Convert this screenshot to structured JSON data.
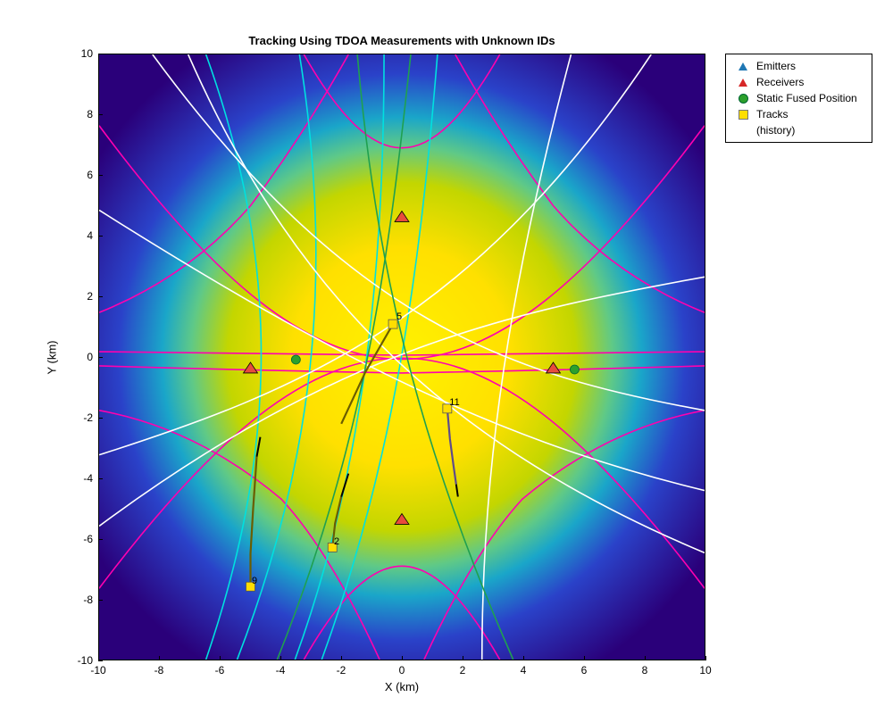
{
  "chart_data": {
    "type": "scatter",
    "title": "Tracking Using TDOA Measurements with Unknown IDs",
    "xlabel": "X (km)",
    "ylabel": "Y (km)",
    "xlim": [
      -10,
      10
    ],
    "ylim": [
      -10,
      10
    ],
    "xticks": [
      -10,
      -8,
      -6,
      -4,
      -2,
      0,
      2,
      4,
      6,
      8,
      10
    ],
    "yticks": [
      -10,
      -8,
      -6,
      -4,
      -2,
      0,
      2,
      4,
      6,
      8,
      10
    ],
    "legend": [
      "Emitters",
      "Receivers",
      "Static Fused Position",
      "Tracks",
      "(history)"
    ],
    "receivers": [
      {
        "x": -5.0,
        "y": 0.0
      },
      {
        "x": 5.0,
        "y": 0.0
      },
      {
        "x": 0.0,
        "y": 5.0
      },
      {
        "x": 0.0,
        "y": -5.0
      }
    ],
    "static_fused": [
      {
        "x": -3.5,
        "y": -0.1
      },
      {
        "x": 5.7,
        "y": -0.4
      }
    ],
    "tracks": [
      {
        "id": 5,
        "x": -0.3,
        "y": 1.1,
        "history": [
          [
            -0.3,
            1.1
          ],
          [
            -1.2,
            -0.5
          ],
          [
            -2.0,
            -2.2
          ]
        ]
      },
      {
        "id": 11,
        "x": 1.5,
        "y": -1.7,
        "history": [
          [
            1.5,
            -1.7
          ],
          [
            1.6,
            -2.7
          ],
          [
            1.7,
            -3.6
          ],
          [
            1.8,
            -4.2
          ]
        ]
      },
      {
        "id": 2,
        "x": -2.3,
        "y": -6.3,
        "history": [
          [
            -2.3,
            -6.3
          ],
          [
            -2.2,
            -5.5
          ],
          [
            -2.0,
            -4.6
          ]
        ]
      },
      {
        "id": 9,
        "x": -5.0,
        "y": -7.6,
        "history": [
          [
            -5.0,
            -7.6
          ],
          [
            -5.0,
            -6.5
          ],
          [
            -4.9,
            -5.0
          ],
          [
            -4.8,
            -3.3
          ]
        ]
      }
    ],
    "hyperbola_families": {
      "magenta": 7,
      "cyan": 4,
      "white": 6,
      "green": 2
    },
    "heatmap": {
      "center": [
        0,
        0
      ],
      "radius_km": 6,
      "palette": "parula"
    }
  }
}
